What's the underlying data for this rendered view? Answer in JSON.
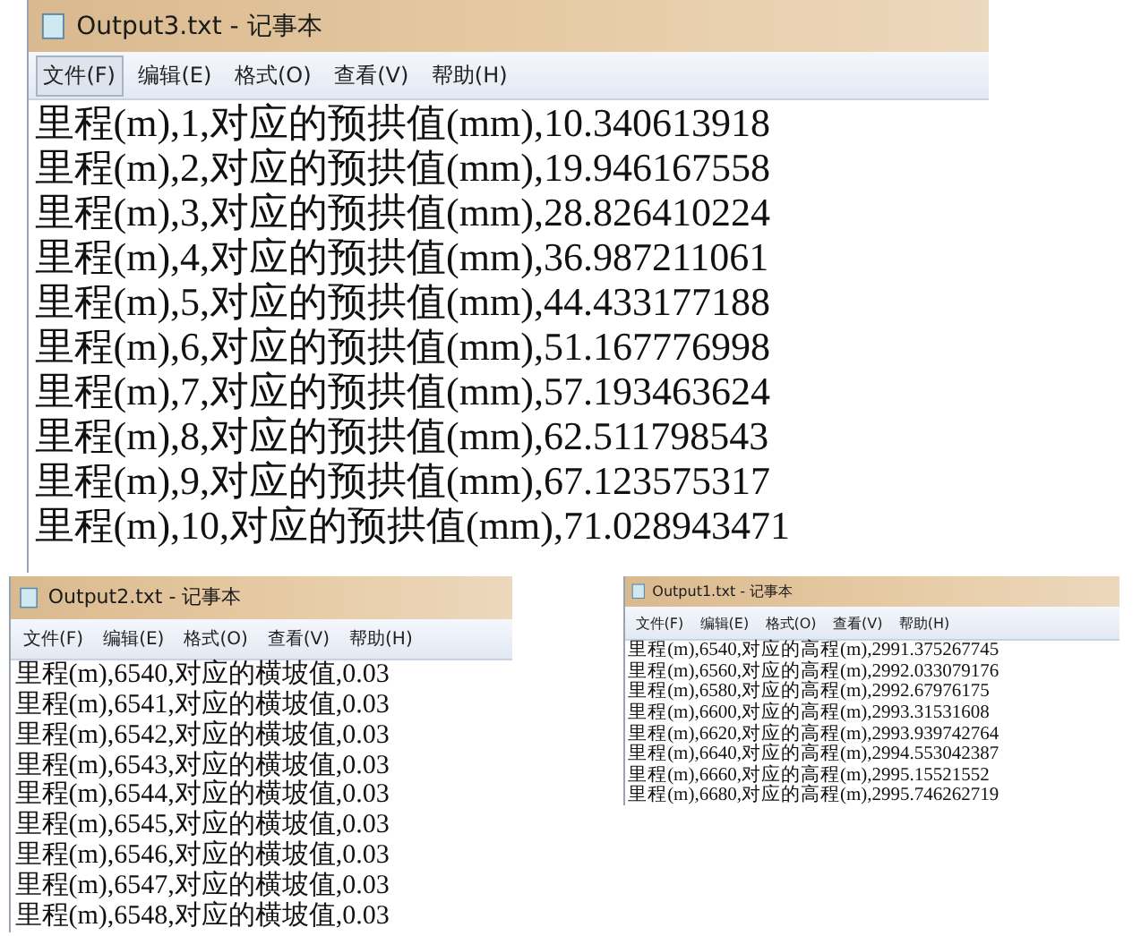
{
  "windows": [
    {
      "title": "Output3.txt - 记事本",
      "menu": [
        {
          "label": "文件(F)",
          "selected": true
        },
        {
          "label": "编辑(E)",
          "selected": false
        },
        {
          "label": "格式(O)",
          "selected": false
        },
        {
          "label": "查看(V)",
          "selected": false
        },
        {
          "label": "帮助(H)",
          "selected": false
        }
      ],
      "lines": [
        "里程(m),1,对应的预拱值(mm),10.340613918",
        "里程(m),2,对应的预拱值(mm),19.946167558",
        "里程(m),3,对应的预拱值(mm),28.826410224",
        "里程(m),4,对应的预拱值(mm),36.987211061",
        "里程(m),5,对应的预拱值(mm),44.433177188",
        "里程(m),6,对应的预拱值(mm),51.167776998",
        "里程(m),7,对应的预拱值(mm),57.193463624",
        "里程(m),8,对应的预拱值(mm),62.511798543",
        "里程(m),9,对应的预拱值(mm),67.123575317",
        "里程(m),10,对应的预拱值(mm),71.028943471"
      ]
    },
    {
      "title": "Output2.txt - 记事本",
      "menu": [
        {
          "label": "文件(F)",
          "selected": false
        },
        {
          "label": "编辑(E)",
          "selected": false
        },
        {
          "label": "格式(O)",
          "selected": false
        },
        {
          "label": "查看(V)",
          "selected": false
        },
        {
          "label": "帮助(H)",
          "selected": false
        }
      ],
      "lines": [
        "里程(m),6540,对应的横坡值,0.03",
        "里程(m),6541,对应的横坡值,0.03",
        "里程(m),6542,对应的横坡值,0.03",
        "里程(m),6543,对应的横坡值,0.03",
        "里程(m),6544,对应的横坡值,0.03",
        "里程(m),6545,对应的横坡值,0.03",
        "里程(m),6546,对应的横坡值,0.03",
        "里程(m),6547,对应的横坡值,0.03",
        "里程(m),6548,对应的横坡值,0.03"
      ]
    },
    {
      "title": "Output1.txt - 记事本",
      "menu": [
        {
          "label": "文件(F)",
          "selected": false
        },
        {
          "label": "编辑(E)",
          "selected": false
        },
        {
          "label": "格式(O)",
          "selected": false
        },
        {
          "label": "查看(V)",
          "selected": false
        },
        {
          "label": "帮助(H)",
          "selected": false
        }
      ],
      "lines": [
        "里程(m),6540,对应的高程(m),2991.375267745",
        "里程(m),6560,对应的高程(m),2992.033079176",
        "里程(m),6580,对应的高程(m),2992.67976175",
        "里程(m),6600,对应的高程(m),2993.31531608",
        "里程(m),6620,对应的高程(m),2993.939742764",
        "里程(m),6640,对应的高程(m),2994.553042387",
        "里程(m),6660,对应的高程(m),2995.15521552",
        "里程(m),6680,对应的高程(m),2995.746262719"
      ]
    }
  ]
}
